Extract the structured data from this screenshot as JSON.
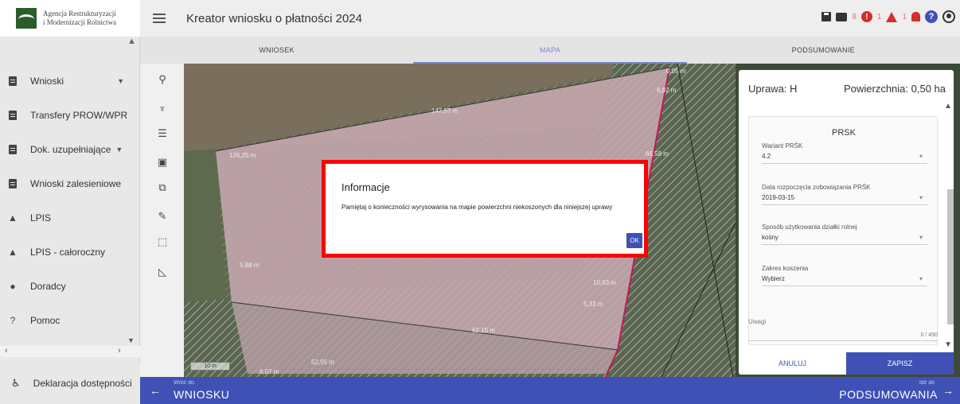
{
  "logo": {
    "line1": "Agencja Restrukturyzacji",
    "line2": "i Modernizacji Rolnictwa"
  },
  "header": {
    "title": "Kreator wniosku o płatności 2024",
    "counts": {
      "errors": "8",
      "warnings": "1",
      "notifications": "1"
    }
  },
  "tabs": [
    {
      "label": "WNIOSEK"
    },
    {
      "label": "MAPA",
      "active": true
    },
    {
      "label": "PODSUMOWANIE"
    }
  ],
  "sidebar": {
    "items": [
      {
        "label": "Wnioski",
        "icon": "document-icon"
      },
      {
        "label": "Transfery PROW/WPR",
        "icon": "document-icon"
      },
      {
        "label": "Dok. uzupełniające",
        "icon": "document-icon"
      },
      {
        "label": "Wnioski zalesieniowe",
        "icon": "document-icon"
      },
      {
        "label": "LPIS",
        "icon": "terrain-icon"
      },
      {
        "label": "LPIS - całoroczny",
        "icon": "terrain-icon"
      },
      {
        "label": "Doradcy",
        "icon": "person-icon"
      },
      {
        "label": "Pomoc",
        "icon": "help-icon"
      }
    ],
    "footer": "Deklaracja dostępności"
  },
  "map": {
    "scale_label": "10 m",
    "labels": [
      "0,05 m",
      "6,92 m",
      "147,57 m",
      "126,25 m",
      "66,58 m",
      "5,88 m",
      "10,83 m",
      "5,33 m",
      "62,15 m",
      "52,55 m",
      "6,07 m"
    ]
  },
  "panel": {
    "uprawa": "Uprawa: H",
    "powierzchnia": "Powierzchnia: 0,50 ha",
    "section_title": "PRSK",
    "fields": [
      {
        "label": "Wariant PRŚK",
        "value": "4.2"
      },
      {
        "label": "Data rozpoczęcia zobowiązania PRŚK",
        "value": "2019-03-15"
      },
      {
        "label": "Sposób użytkowania działki rolnej",
        "value": "kośny"
      },
      {
        "label": "Zakres koszenia",
        "value": "Wybierz"
      }
    ],
    "notes_label": "Uwagi",
    "notes_count": "0 / 450",
    "cancel": "ANULUJ",
    "save": "ZAPISZ"
  },
  "bottom_nav": {
    "back_small": "Wróć do",
    "back_big": "WNIOSKU",
    "next_small": "Idź do",
    "next_big": "PODSUMOWANIA"
  },
  "dialog": {
    "title": "Informacje",
    "message": "Pamiętaj o konieczności wyrysowania na mapie powierzchni niekoszonych dla niniejszej uprawy",
    "ok": "OK"
  },
  "colors": {
    "primary": "#3f51b5",
    "alert": "#d32f2f",
    "dialog_border": "#ff0000"
  }
}
